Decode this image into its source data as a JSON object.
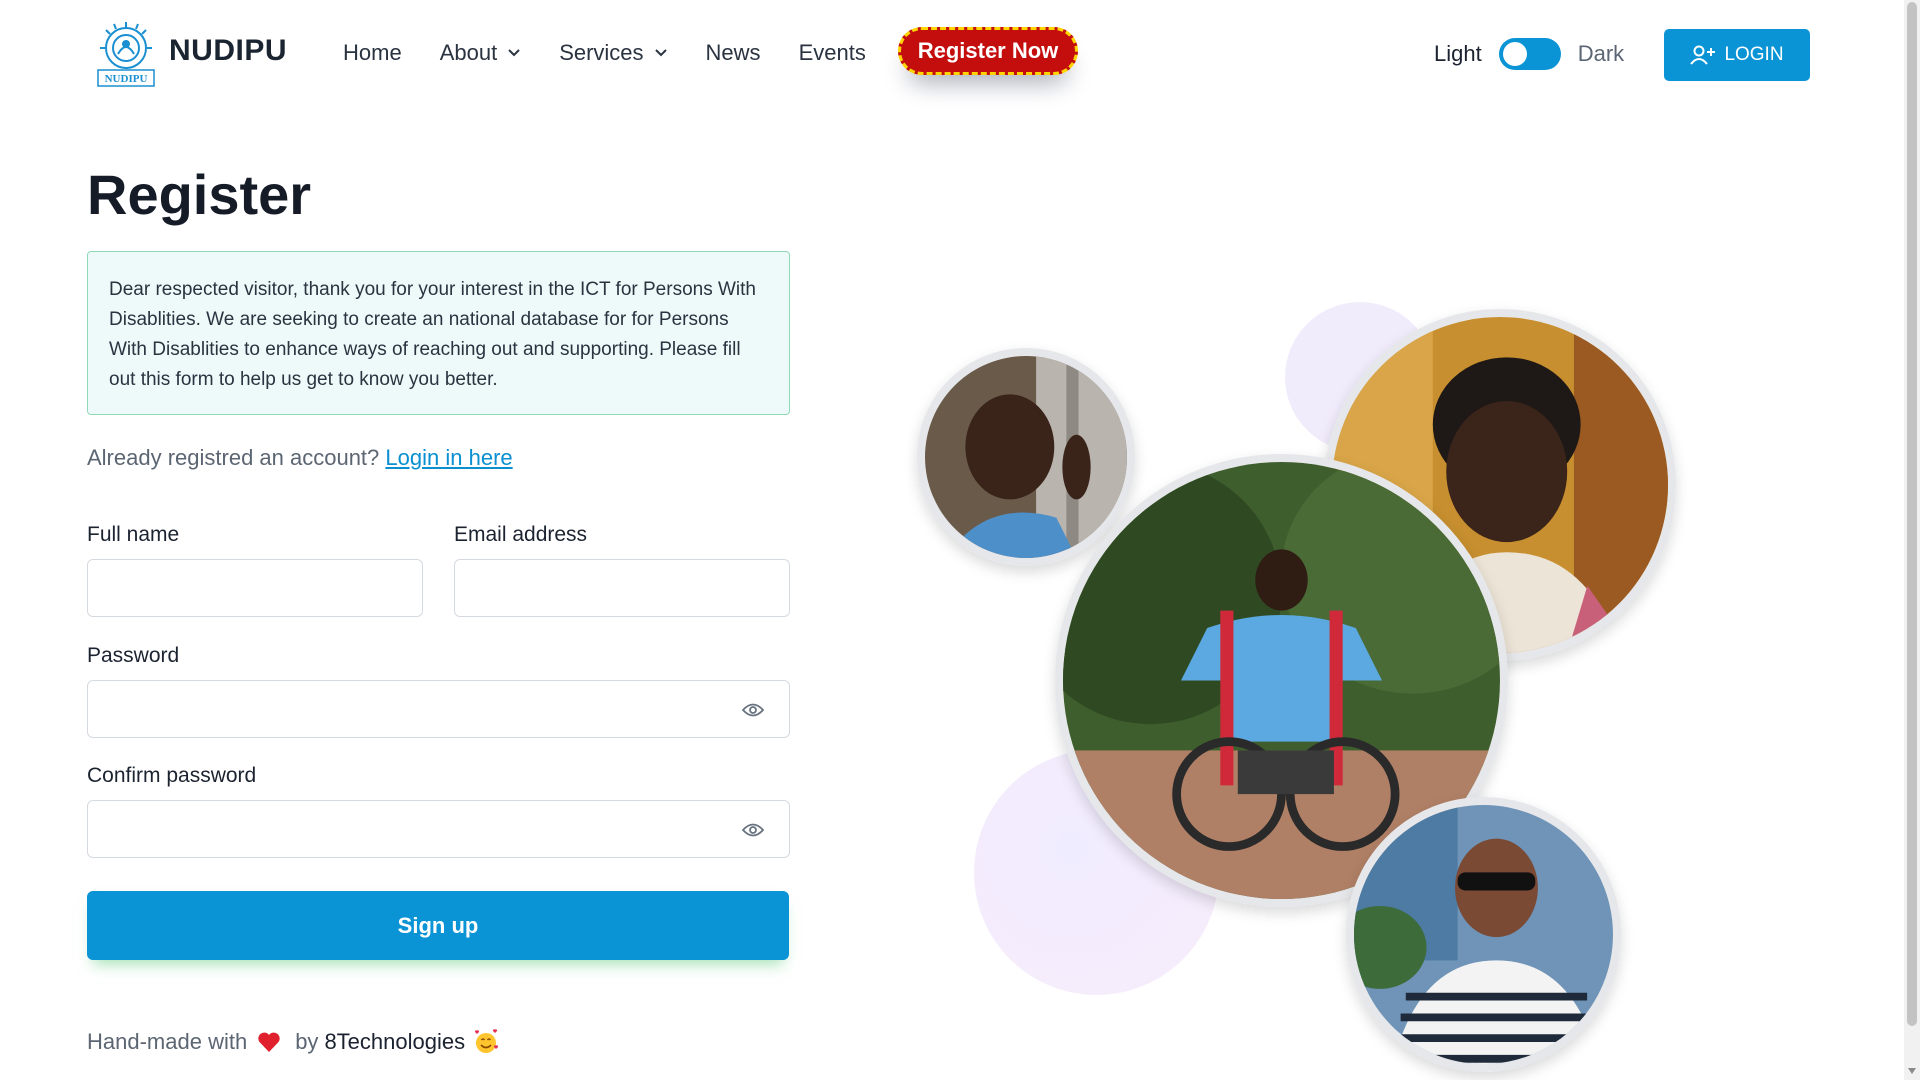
{
  "header": {
    "brand": "NUDIPU",
    "nav": [
      {
        "label": "Home",
        "has_dropdown": false
      },
      {
        "label": "About",
        "has_dropdown": true
      },
      {
        "label": "Services",
        "has_dropdown": true
      },
      {
        "label": "News",
        "has_dropdown": false
      },
      {
        "label": "Events",
        "has_dropdown": false
      }
    ],
    "register_now": "Register Now",
    "theme_light": "Light",
    "theme_dark": "Dark",
    "theme_toggle_state": "light",
    "login_label": "LOGIN"
  },
  "main": {
    "title": "Register",
    "notice": "Dear respected visitor, thank you for your interest in the ICT for Persons With Disablities. We are seeking to create an national database for for Persons With Disablities to enhance ways of reaching out and supporting. Please fill out this form to help us get to know you better.",
    "already_text": "Already registred an account?",
    "login_link": "Login in here",
    "fields": {
      "full_name_label": "Full name",
      "full_name_value": "",
      "email_label": "Email address",
      "email_value": "",
      "password_label": "Password",
      "password_value": "",
      "confirm_label": "Confirm password",
      "confirm_value": ""
    },
    "signup_label": "Sign up",
    "footer_prefix": "Hand-made with",
    "footer_by": "by",
    "footer_company": "8Technologies"
  },
  "colors": {
    "accent": "#0a94d6",
    "register_bg": "#c40e0e",
    "register_border": "#ffd400",
    "notice_bg": "#eefaf9",
    "notice_border": "#8fd9b7"
  },
  "icons": {
    "logo": "nudipu-logo",
    "login": "user-plus-icon",
    "password_toggle": "eye-icon",
    "footer_heart": "heart-icon",
    "footer_emoji": "smiling-face-with-hearts-icon"
  }
}
